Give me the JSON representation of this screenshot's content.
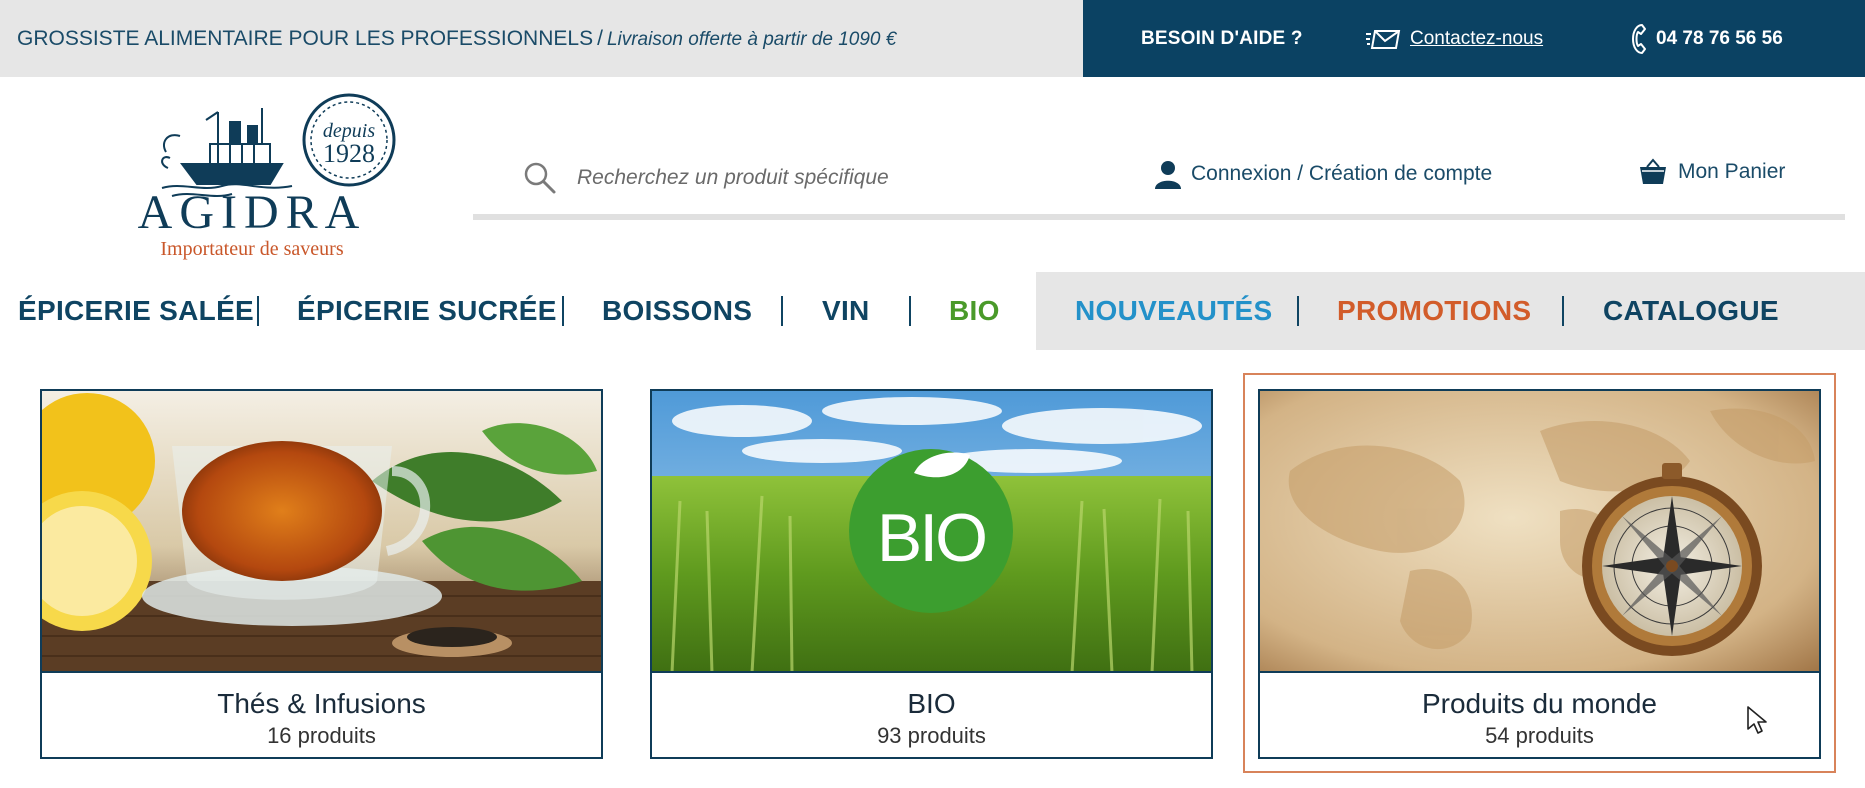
{
  "topbar": {
    "tagline": "GROSSISTE ALIMENTAIRE POUR LES PROFESSIONNELS",
    "separator": "/",
    "delivery": "Livraison offerte à partir de 1090 €",
    "help": "BESOIN D'AIDE ?",
    "contact": "Contactez-nous",
    "phone": "04 78 76 56 56"
  },
  "logo": {
    "name": "AGIDRA",
    "subtitle": "Importateur de saveurs",
    "badge_top": "depuis",
    "badge_year": "1928"
  },
  "header": {
    "search_placeholder": "Recherchez un produit spécifique",
    "account": "Connexion / Création de compte",
    "cart": "Mon Panier"
  },
  "nav": {
    "items": [
      "ÉPICERIE SALÉE",
      "ÉPICERIE SUCRÉE",
      "BOISSONS",
      "VIN",
      "BIO",
      "NOUVEAUTÉS",
      "PROMOTIONS",
      "CATALOGUE"
    ]
  },
  "cards": [
    {
      "title": "Thés & Infusions",
      "count": "16 produits"
    },
    {
      "title": "BIO",
      "count": "93 produits",
      "badge": "BIO"
    },
    {
      "title": "Produits du monde",
      "count": "54 produits"
    }
  ],
  "colors": {
    "navy": "#0b4263",
    "bio_green": "#4a9a2a",
    "new_blue": "#2391c9",
    "promo_orange": "#d25c2a",
    "highlight": "#d8835a"
  }
}
